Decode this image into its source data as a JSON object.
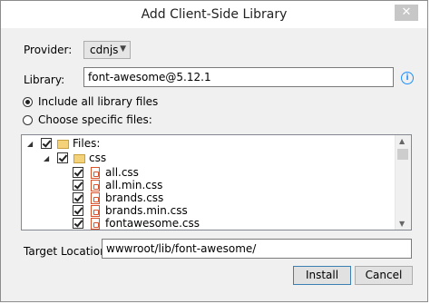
{
  "window": {
    "title": "Add Client-Side Library",
    "close_glyph": "✕"
  },
  "form": {
    "provider_label": "Provider:",
    "provider_value": "cdnjs",
    "library_label": "Library:",
    "library_value": "font-awesome@5.12.1",
    "info_glyph": "i",
    "option_all_label": "Include all library files",
    "option_specific_label": "Choose specific files:",
    "selected_option": "Include all library files",
    "target_label": "Target Location:",
    "target_value": "wwwroot/lib/font-awesome/"
  },
  "tree": {
    "root_label": "Files:",
    "folder_label": "css",
    "files": [
      "all.css",
      "all.min.css",
      "brands.css",
      "brands.min.css",
      "fontawesome.css"
    ]
  },
  "buttons": {
    "install": "Install",
    "cancel": "Cancel"
  },
  "icons": {
    "close": "close-icon",
    "dropdown": "chevron-down-icon",
    "info": "info-icon",
    "folder": "folder-icon",
    "file": "css-file-icon",
    "expander": "expander-arrow-icon"
  },
  "colors": {
    "dialog_background": "#f0f0f0",
    "info_accent": "#1e90ff",
    "file_icon": "#d9532c",
    "folder_icon": "#f3d27a"
  }
}
